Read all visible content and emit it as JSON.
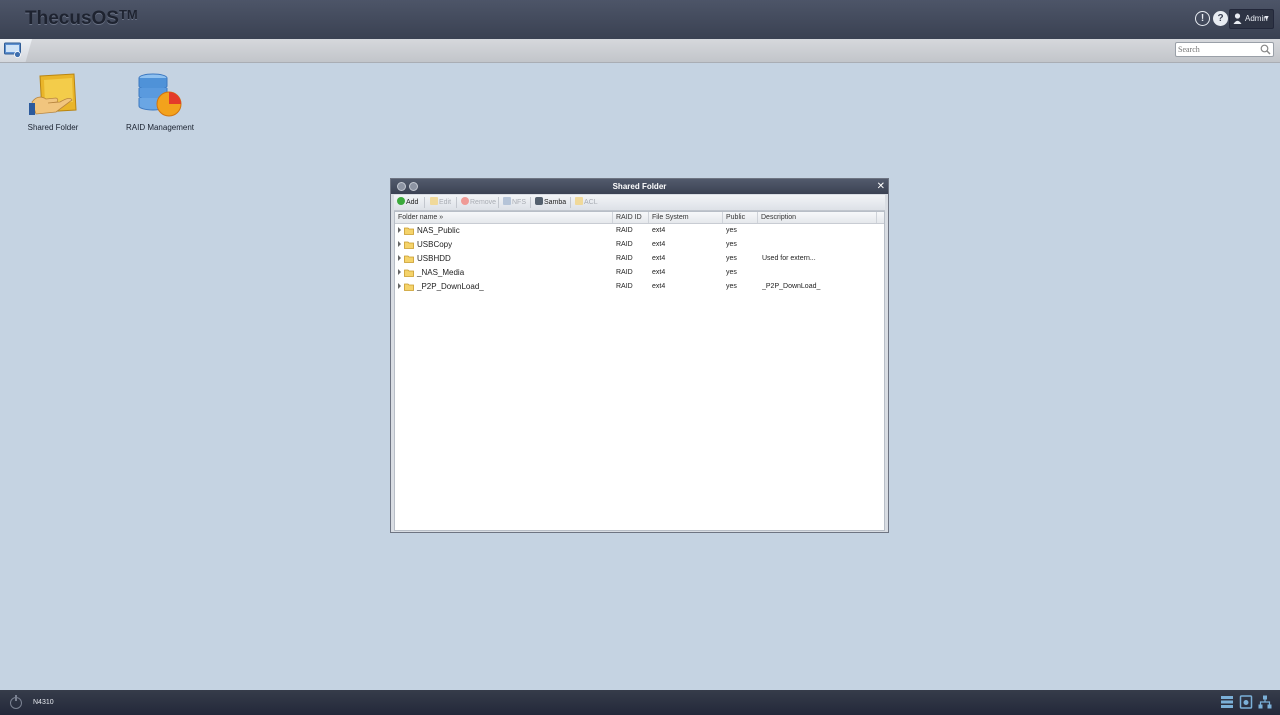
{
  "app": {
    "logo": "ThecusOS",
    "logo_tm": "TM",
    "user_label": "Admin",
    "search_placeholder": "Search"
  },
  "desktop": {
    "icons": [
      {
        "label": "Shared Folder",
        "icon": "shared-folder-icon"
      },
      {
        "label": "RAID Management",
        "icon": "raid-management-icon"
      }
    ]
  },
  "window": {
    "title": "Shared Folder",
    "toolbar": [
      {
        "label": "Add",
        "enabled": true,
        "icon": "add-icon"
      },
      {
        "label": "Edit",
        "enabled": false,
        "icon": "edit-icon"
      },
      {
        "label": "Remove",
        "enabled": false,
        "icon": "remove-icon"
      },
      {
        "label": "NFS",
        "enabled": false,
        "icon": "nfs-icon"
      },
      {
        "label": "Samba",
        "enabled": true,
        "icon": "samba-icon"
      },
      {
        "label": "ACL",
        "enabled": false,
        "icon": "acl-icon"
      }
    ],
    "columns": {
      "name": "Folder name",
      "raid": "RAID ID",
      "fs": "File System",
      "public": "Public",
      "desc": "Description"
    },
    "rows": [
      {
        "name": "NAS_Public",
        "raid": "RAID",
        "fs": "ext4",
        "public": "yes",
        "desc": ""
      },
      {
        "name": "USBCopy",
        "raid": "RAID",
        "fs": "ext4",
        "public": "yes",
        "desc": ""
      },
      {
        "name": "USBHDD",
        "raid": "RAID",
        "fs": "ext4",
        "public": "yes",
        "desc": "Used for extern..."
      },
      {
        "name": "_NAS_Media",
        "raid": "RAID",
        "fs": "ext4",
        "public": "yes",
        "desc": ""
      },
      {
        "name": "_P2P_DownLoad_",
        "raid": "RAID",
        "fs": "ext4",
        "public": "yes",
        "desc": "_P2P_DownLoad_"
      }
    ]
  },
  "taskbar": {
    "model": "N4310",
    "tray": [
      "storage-icon",
      "disk-icon",
      "network-icon"
    ]
  },
  "colors": {
    "desktop_bg": "#c5d3e2",
    "topbar": "#3f4658",
    "window_title": "#474e60"
  }
}
